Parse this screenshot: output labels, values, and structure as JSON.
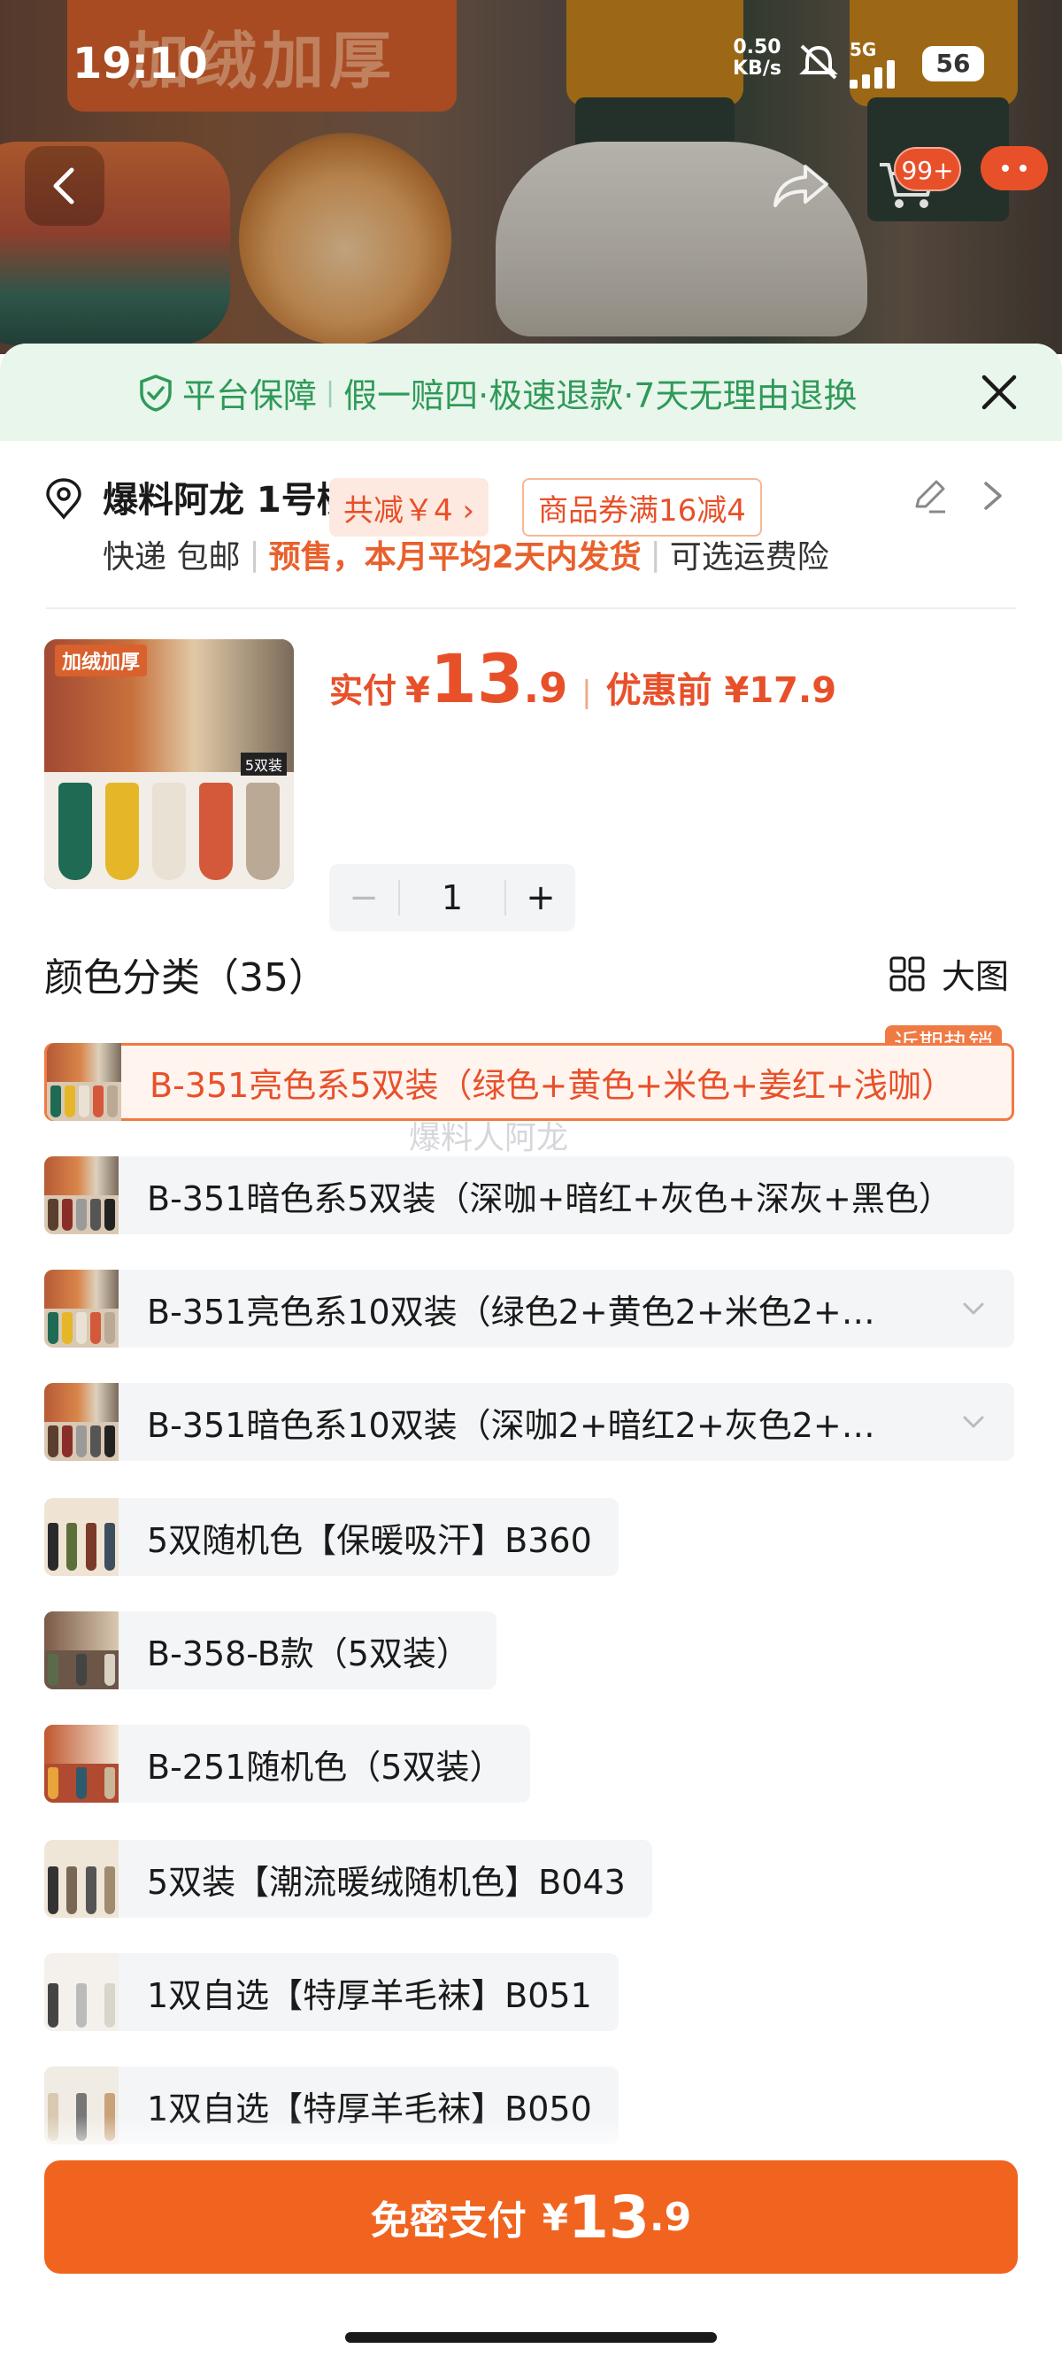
{
  "status_bar": {
    "time": "19:10",
    "net_speed": "0.50",
    "net_unit": "KB/s",
    "network": "5G",
    "battery": "56"
  },
  "photo": {
    "banner_text": "加绒加厚",
    "cart_badge": "99+"
  },
  "guarantee": {
    "title": "平台保障",
    "items": "假一赔四·极速退款·7天无理由退换"
  },
  "address": {
    "name": "爆料阿龙 1号楼",
    "shipping_express": "快递 包邮",
    "presale": "预售，本月平均2天内发货",
    "insurance": "可选运费险"
  },
  "product": {
    "thumb_tag": "加绒加厚",
    "thumb_pack": "5双装",
    "pay_label": "实付",
    "currency": "¥",
    "price_int": "13",
    "price_dec": ".9",
    "before_label": "优惠前 ¥17.9",
    "discount_chip": "共减￥4 ›",
    "coupon_chip": "商品券满16减4",
    "quantity": "1",
    "minus": "−",
    "plus": "+"
  },
  "color_section": {
    "title": "颜色分类（35）",
    "big_view": "大图",
    "hot_tag": "近期热销",
    "watermark": "爆料人阿龙",
    "options": [
      {
        "label": "B-351亮色系5双装（绿色+黄色+米色+姜红+浅咖）",
        "selected": true
      },
      {
        "label": "B-351暗色系5双装（深咖+暗红+灰色+深灰+黑色）",
        "selected": false
      },
      {
        "label": "B-351亮色系10双装（绿色2+黄色2+米色2+姜...",
        "selected": false
      },
      {
        "label": "B-351暗色系10双装（深咖2+暗红2+灰色2+深...",
        "selected": false
      },
      {
        "label": "5双随机色【保暖吸汗】B360",
        "selected": false
      },
      {
        "label": "B-358-B款（5双装）",
        "selected": false
      },
      {
        "label": "B-251随机色（5双装）",
        "selected": false
      },
      {
        "label": "5双装【潮流暖绒随机色】B043",
        "selected": false
      },
      {
        "label": "1双自选【特厚羊毛袜】B051",
        "selected": false
      },
      {
        "label": "1双自选【特厚羊毛袜】B050",
        "selected": false
      }
    ]
  },
  "pay_button": {
    "label": "免密支付",
    "currency": "¥",
    "price_int": "13",
    "price_dec": ".9"
  },
  "colors": {
    "accent": "#f06420",
    "price": "#e8502a",
    "guarantee_green": "#2f9a58"
  }
}
